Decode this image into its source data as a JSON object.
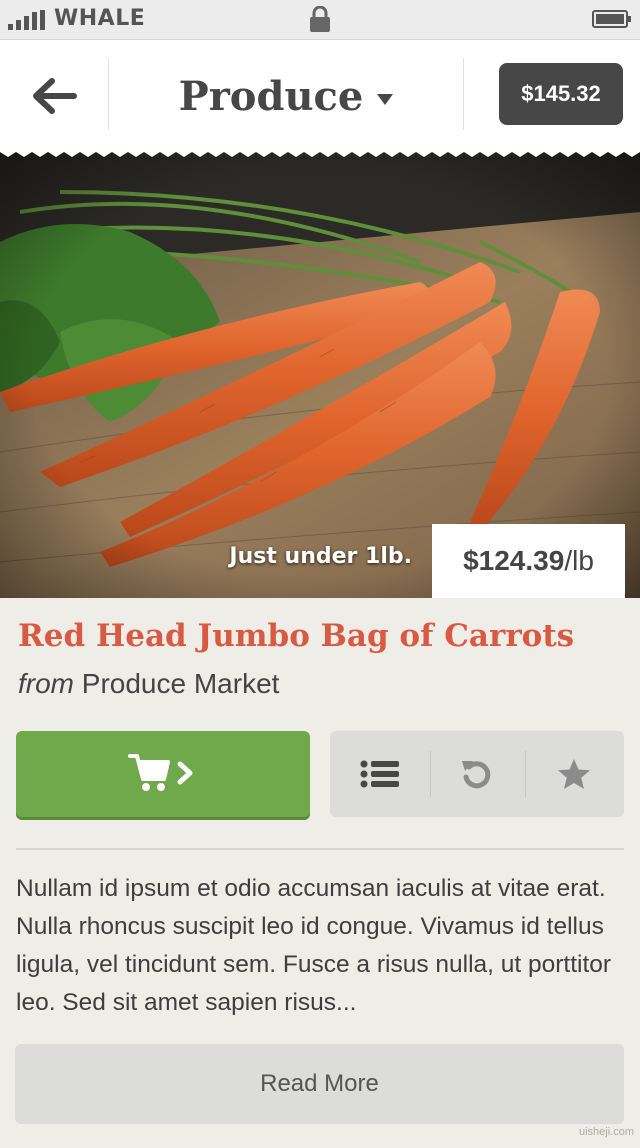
{
  "status_bar": {
    "carrier": "WHALE",
    "signal_icon": "signal-bars-icon",
    "lock_icon": "lock-icon",
    "battery_icon": "battery-icon"
  },
  "header": {
    "back_icon": "arrow-left-icon",
    "title": "Produce",
    "dropdown_icon": "caret-down-icon",
    "cart_total": "$145.32"
  },
  "product": {
    "image": "carrots-photo",
    "weight_note": "Just under 1lb.",
    "price": "$124.39",
    "price_unit": "/lb",
    "name": "Red Head Jumbo Bag of Carrots",
    "from_label": "from",
    "vendor": "Produce Market"
  },
  "actions": {
    "add_to_cart_icon": "cart-icon",
    "add_to_cart_arrow": "chevron-right-icon",
    "list_icon": "list-icon",
    "undo_icon": "undo-icon",
    "favorite_icon": "star-icon"
  },
  "description": "Nullam id ipsum et odio accumsan iaculis at vitae erat. Nulla rhoncus suscipit leo id congue. Vivamus id tellus ligula, vel tincidunt sem. Fusce a risus nulla, ut porttitor leo. Sed sit amet sapien risus...",
  "read_more_label": "Read More",
  "watermark": "uisheji.com",
  "colors": {
    "accent_red": "#d95a42",
    "cart_green": "#70a94b",
    "dark_badge": "#474747",
    "background": "#efede8"
  }
}
